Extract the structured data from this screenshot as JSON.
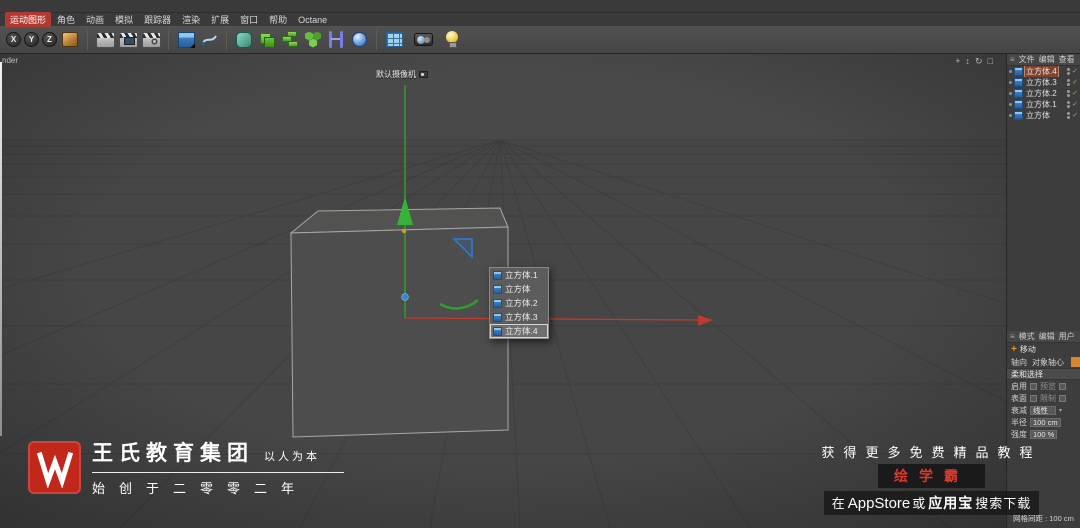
{
  "icons": {
    "hamburger": "≡",
    "check": "✓",
    "plus": "+",
    "dropdown_arrow": "▾"
  },
  "menubar": {
    "items": [
      "运动图形",
      "角色",
      "动画",
      "模拟",
      "跟踪器",
      "渲染",
      "扩展",
      "窗口",
      "帮助",
      "Octane"
    ]
  },
  "toolbar": {
    "axis": [
      "X",
      "Y",
      "Z"
    ]
  },
  "viewport": {
    "menu_remnant": "nder",
    "camera_label": "默认摄像机",
    "controls": [
      {
        "name": "pan",
        "glyph": "+"
      },
      {
        "name": "dolly",
        "glyph": "↕"
      },
      {
        "name": "rotate",
        "glyph": "↻"
      },
      {
        "name": "toggle-view",
        "glyph": "□"
      }
    ]
  },
  "popup": {
    "items": [
      "立方体.1",
      "立方体",
      "立方体.2",
      "立方体.3",
      "立方体.4"
    ]
  },
  "object_manager": {
    "menus": [
      "文件",
      "编辑",
      "查看"
    ],
    "objects": [
      "立方体.4",
      "立方体.3",
      "立方体.2",
      "立方体.1",
      "立方体"
    ]
  },
  "attributes": {
    "menus": [
      "模式",
      "编辑",
      "用户"
    ],
    "tool_label": "移动",
    "tabs": [
      "轴向",
      "对象轴心"
    ],
    "section_title": "柔和选择",
    "fields": {
      "enable_label": "启用",
      "preview_label": "预览",
      "surface_label": "表面",
      "limit_label": "限制",
      "falloff_label": "衰减",
      "falloff_value": "线性",
      "radius_label": "半径",
      "radius_value": "100 cm",
      "strength_label": "强度",
      "strength_value": "100 %"
    }
  },
  "statusbar": {
    "grid_spacing": "网格间距 : 100 cm"
  },
  "watermark_left": {
    "brand": "王氏教育集团",
    "tagline": "以人为本",
    "subtitle": "始创于二零零二年"
  },
  "watermark_right": {
    "line1": "获得更多免费精品教程",
    "brand": "绘学霸",
    "line2_pre": "在",
    "line2_store1": "AppStore",
    "line2_mid": "或",
    "line2_store2": "应用宝",
    "line2_post": "搜索下载"
  }
}
